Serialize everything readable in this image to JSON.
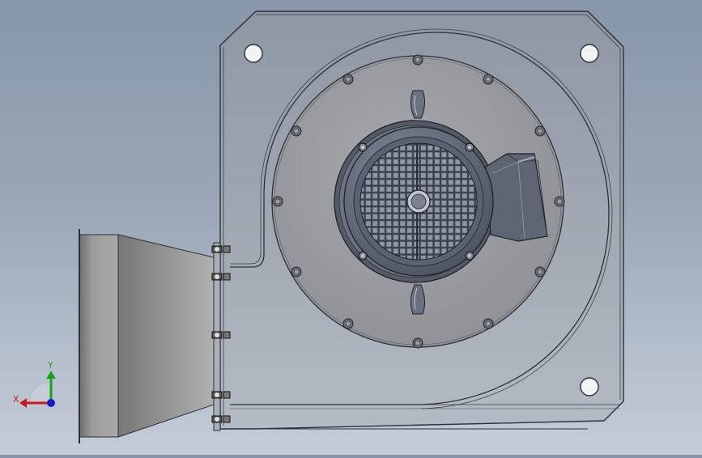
{
  "viewport": {
    "background_top": "#8796a9",
    "background_bottom": "#c3ccd7"
  },
  "triad": {
    "x_label": "X",
    "y_label": "Y",
    "x_color": "#cc1a1a",
    "y_color": "#1aa01a",
    "z_color": "#1a1acc"
  },
  "model": {
    "housing_color": "#a8b0ba",
    "backplate_color": "#9aa1aa",
    "motor_color": "#6e7685",
    "outlet_color": "#9a9a9a"
  }
}
